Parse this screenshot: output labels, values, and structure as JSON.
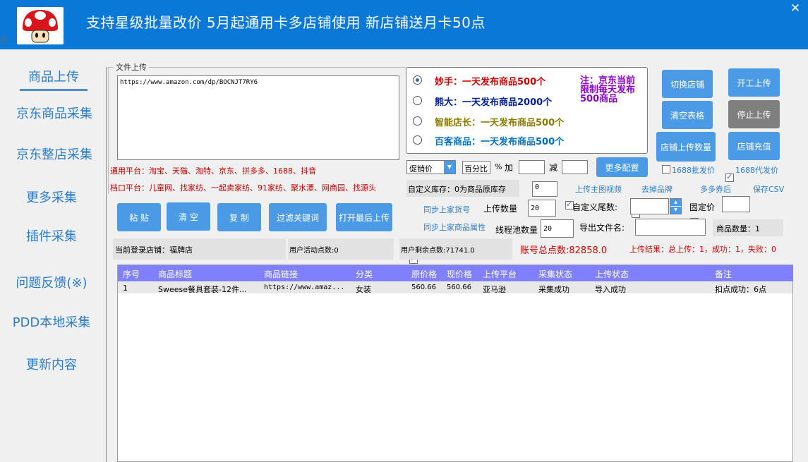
{
  "header": {
    "banner": "支持星级批量改价 5月起通用卡多店铺使用 新店铺送月卡50点",
    "close_glyph": "✕",
    "left_edge_glyph": "全"
  },
  "nav": {
    "items": [
      {
        "label": "商品上传"
      },
      {
        "label": "京东商品采集"
      },
      {
        "label": "京东整店采集"
      },
      {
        "label": "更多采集"
      },
      {
        "label": "插件采集"
      },
      {
        "label": "问题反馈(※)"
      },
      {
        "label": "PDD本地采集"
      },
      {
        "label": "更新内容"
      }
    ]
  },
  "upload": {
    "group_label": "文件上传",
    "url_value": "https://www.amazon.com/dp/BOCNJT7RY6",
    "general_platforms": "通用平台：淘宝、天猫、淘特、京东、拼多多、1688、抖音",
    "stall_platforms": "档口平台：儿童网、找家纺、一起卖家纺、91家纺、聚水潭、网商园、找源头"
  },
  "plans": [
    {
      "text": "妙手：一天发布商品500个",
      "color": "#d00000",
      "selected": true
    },
    {
      "text": "熊大：一天发布商品2000个",
      "color": "#00209a",
      "selected": false
    },
    {
      "text": "智能店长：一天发布商品500个",
      "color": "#8a7a00",
      "selected": false
    },
    {
      "text": "百客商品：一天发布商品500个",
      "color": "#0070c0",
      "selected": false
    }
  ],
  "note": "注：京东当前限制每天发布500商品",
  "buttons": {
    "switch_shop": "切换店铺",
    "start_upload": "开工上传",
    "clear_table": "清空表格",
    "stop_upload": "停止上传",
    "shop_upload_count": "店铺上传数量",
    "shop_recharge": "店铺充值",
    "more_config": "更多配置",
    "paste": "粘 贴",
    "clear": "清 空",
    "copy": "复 制",
    "filter_keywords": "过滤关键词",
    "open_last_upload": "打开最后上传"
  },
  "pricing": {
    "price_type": "促销价",
    "mode": "百分比",
    "percent_sign": "%",
    "add_label": "加",
    "add_value": "",
    "minus_label": "减",
    "minus_value": "",
    "dropdown_glyph": "▼"
  },
  "options": {
    "wholesale_1688": {
      "label": "1688批发价",
      "checked": false
    },
    "dropship_1688": {
      "label": "1688代发价",
      "checked": true
    },
    "custom_stock_label": "自定义库存：0为商品原库存",
    "custom_stock_value": "0",
    "upload_main_video": {
      "label": "上传主图视频",
      "checked": true
    },
    "remove_brand": {
      "label": "去掉品牌",
      "checked": true
    },
    "multi_coupon": {
      "label": "多多券后",
      "checked": false
    },
    "save_csv": {
      "label": "保存CSV",
      "checked": false
    },
    "sync_sku": {
      "label": "同步上家货号",
      "checked": true
    },
    "upload_count_label": "上传数量",
    "upload_count_value": "20",
    "custom_tail_label": "自定义尾数:",
    "custom_tail_value": "",
    "fixed_price_label": "固定价",
    "fixed_price_value": "",
    "sync_attrs": {
      "label": "同步上家商品属性",
      "checked": true
    },
    "thread_pool_label": "线程池数量",
    "thread_pool_value": "20",
    "export_name_label": "导出文件名:",
    "export_name_value": "",
    "product_count": "商品数量：1"
  },
  "status": {
    "current_shop": "当前登录店铺：福牌店",
    "user_activity": "用户活动点数:0",
    "user_remaining": "用户剩余点数:71741.0",
    "account_total": "账号总点数:82858.0",
    "upload_result": "上传结果：总上传：1，成功：1，失败：0"
  },
  "table": {
    "columns": [
      "序号",
      "商品标题",
      "商品链接",
      "分类",
      "原价格",
      "现价格",
      "上传平台",
      "采集状态",
      "上传状态",
      "备注"
    ],
    "rows": [
      [
        "1",
        "Sweese餐具套装-12件...",
        "https://www.amaz...",
        "女装",
        "560.66",
        "560.66",
        "亚马逊",
        "采集成功",
        "导入成功",
        "扣点成功：6点"
      ]
    ]
  }
}
